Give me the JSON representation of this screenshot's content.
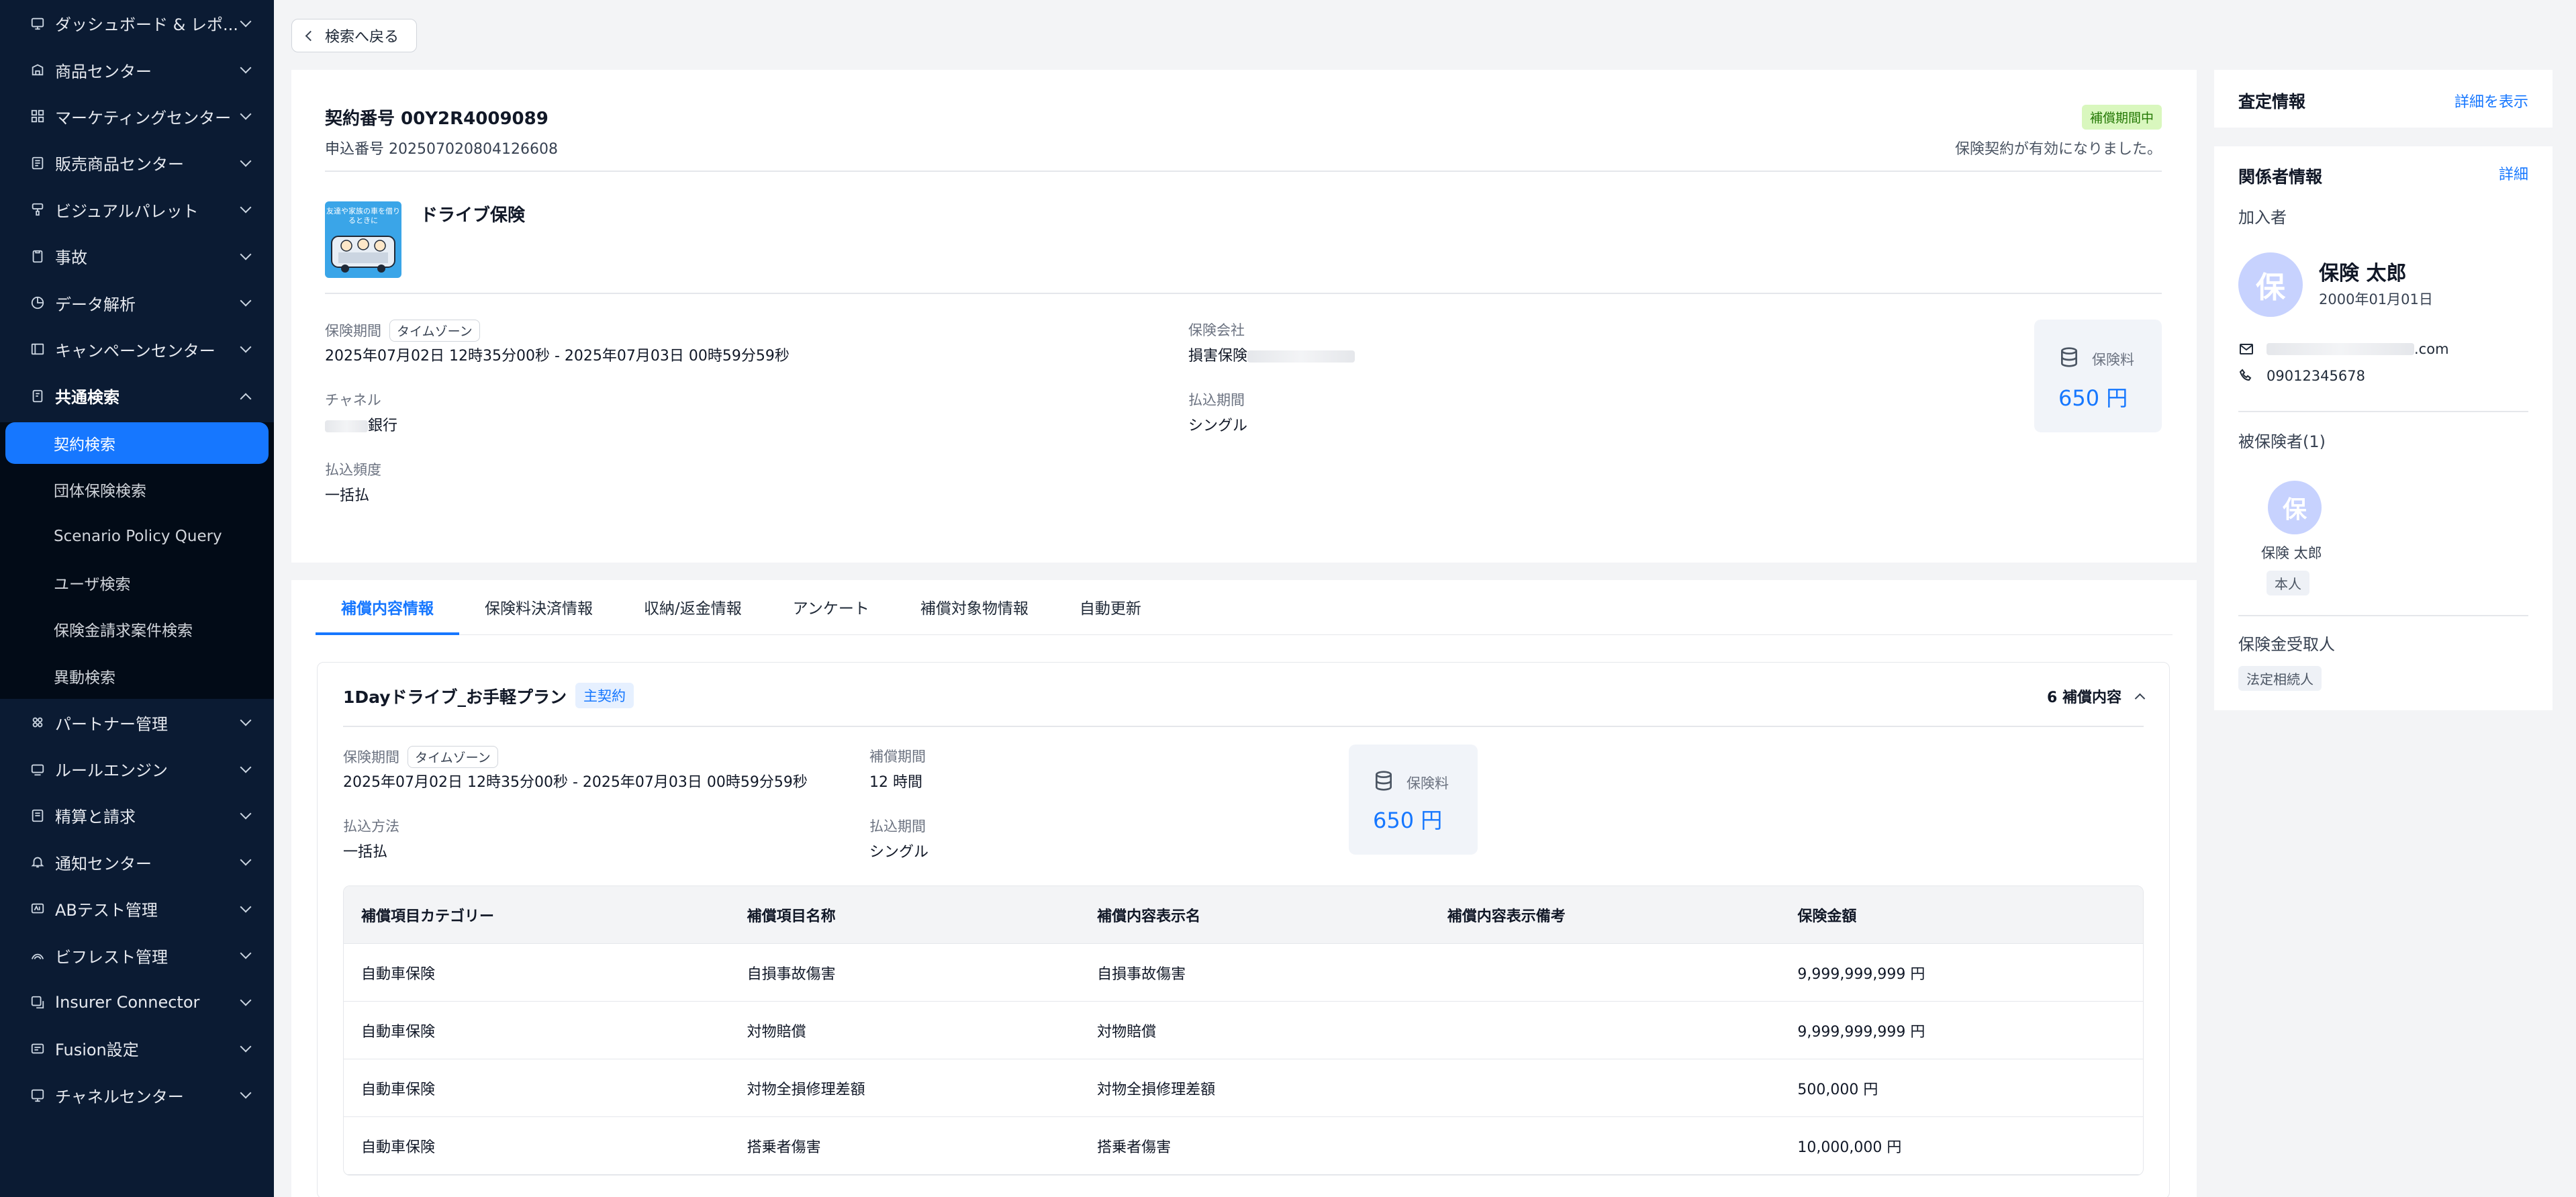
{
  "sidebar": {
    "items_top": [
      {
        "label": "ダッシュボード & レポ...",
        "icon": "dashboard-icon"
      },
      {
        "label": "商品センター",
        "icon": "product-icon"
      },
      {
        "label": "マーケティングセンター",
        "icon": "marketing-icon"
      },
      {
        "label": "販売商品センター",
        "icon": "sales-icon"
      },
      {
        "label": "ビジュアルパレット",
        "icon": "palette-icon"
      },
      {
        "label": "事故",
        "icon": "accident-icon"
      },
      {
        "label": "データ解析",
        "icon": "chart-icon"
      },
      {
        "label": "キャンペーンセンター",
        "icon": "campaign-icon"
      }
    ],
    "expanded": {
      "label": "共通検索",
      "icon": "search-doc-icon"
    },
    "sub_items": [
      "契約検索",
      "団体保険検索",
      "Scenario Policy Query",
      "ユーザ検索",
      "保険金請求案件検索",
      "異動検索"
    ],
    "items_bottom": [
      {
        "label": "パートナー管理",
        "icon": "partner-icon"
      },
      {
        "label": "ルールエンジン",
        "icon": "rule-icon"
      },
      {
        "label": "精算と請求",
        "icon": "billing-icon"
      },
      {
        "label": "通知センター",
        "icon": "bell-icon"
      },
      {
        "label": "ABテスト管理",
        "icon": "abtest-icon"
      },
      {
        "label": "ビフレスト管理",
        "icon": "bifrost-icon"
      },
      {
        "label": "Insurer Connector",
        "icon": "connector-icon"
      },
      {
        "label": "Fusion設定",
        "icon": "fusion-icon"
      },
      {
        "label": "チャネルセンター",
        "icon": "channel-icon"
      }
    ]
  },
  "back_label": "検索へ戻る",
  "contract": {
    "title": "契約番号 00Y2R4009089",
    "application_no": "申込番号 202507020804126608",
    "status": "補償期間中",
    "status_message": "保険契約が有効になりました。",
    "product_name": "ドライブ保険",
    "product_image_text": "友達や家族の車を借りるときに",
    "period_label": "保険期間",
    "timezone_label": "タイムゾーン",
    "period_value": "2025年07月02日 12時35分00秒 - 2025年07月03日 00時59分59秒",
    "channel_label": "チャネル",
    "channel_value": "銀行",
    "frequency_label": "払込頻度",
    "frequency_value": "一括払",
    "insurer_label": "保険会社",
    "insurer_value": "損害保険",
    "payment_period_label": "払込期間",
    "payment_period_value": "シングル",
    "premium_label": "保険料",
    "premium_value": "650 円"
  },
  "tabs": [
    "補償内容情報",
    "保険料決済情報",
    "収納/返金情報",
    "アンケート",
    "補償対象物情報",
    "自動更新"
  ],
  "plan": {
    "title": "1Dayドライブ_お手軽プラン",
    "badge": "主契約",
    "count": "6 補償内容",
    "period_label": "保険期間",
    "timezone_label": "タイムゾーン",
    "period_value": "2025年07月02日 12時35分00秒 - 2025年07月03日 00時59分59秒",
    "coverage_period_label": "補償期間",
    "coverage_period_value": "12 時間",
    "payment_method_label": "払込方法",
    "payment_method_value": "一括払",
    "payment_period_label": "払込期間",
    "payment_period_value": "シングル",
    "premium_label": "保険料",
    "premium_value": "650 円"
  },
  "coverage_table": {
    "headers": [
      "補償項目カテゴリー",
      "補償項目名称",
      "補償内容表示名",
      "補償内容表示備考",
      "保険金額"
    ],
    "rows": [
      [
        "自動車保険",
        "自損事故傷害",
        "自損事故傷害",
        "",
        "9,999,999,999 円"
      ],
      [
        "自動車保険",
        "対物賠償",
        "対物賠償",
        "",
        "9,999,999,999 円"
      ],
      [
        "自動車保険",
        "対物全損修理差額",
        "対物全損修理差額",
        "",
        "500,000 円"
      ],
      [
        "自動車保険",
        "搭乗者傷害",
        "搭乗者傷害",
        "",
        "10,000,000 円"
      ]
    ]
  },
  "assessment": {
    "title": "査定情報",
    "link": "詳細を表示"
  },
  "parties": {
    "title": "関係者情報",
    "link": "詳細",
    "policyholder_label": "加入者",
    "avatar_char": "保",
    "name": "保険 太郎",
    "dob": "2000年01月01日",
    "email_suffix": ".com",
    "phone": "09012345678",
    "insured_label": "被保険者(1)",
    "insured_name": "保険 太郎",
    "insured_relation": "本人",
    "beneficiary_label": "保険金受取人",
    "beneficiary_value": "法定相続人"
  },
  "colors": {
    "sidebar_bg": "#0b1b33",
    "accent": "#1677ff",
    "status_bg": "#d9f7be",
    "status_text": "#237804"
  }
}
